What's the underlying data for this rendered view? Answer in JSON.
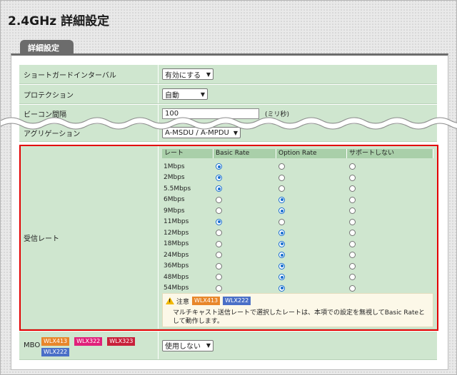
{
  "page": {
    "title": "2.4GHz 詳細設定"
  },
  "tab": {
    "label": "詳細設定"
  },
  "rows": {
    "short_guard": {
      "label": "ショートガードインターバル",
      "value": "有効にする"
    },
    "protection": {
      "label": "プロテクション",
      "value": "自動"
    },
    "beacon": {
      "label": "ビーコン間隔",
      "value": "100",
      "unit": "(ミリ秒)"
    },
    "aggregation": {
      "label": "アグリゲーション",
      "value": "A-MSDU / A-MPDU"
    },
    "receive_rate": {
      "label": "受信レート"
    },
    "mbo": {
      "label": "MBO",
      "value": "使用しない"
    }
  },
  "rate_table": {
    "headers": [
      "レート",
      "Basic Rate",
      "Option Rate",
      "サポートしない"
    ],
    "rates": [
      {
        "name": "1Mbps",
        "selected": "basic"
      },
      {
        "name": "2Mbps",
        "selected": "basic"
      },
      {
        "name": "5.5Mbps",
        "selected": "basic"
      },
      {
        "name": "6Mbps",
        "selected": "option"
      },
      {
        "name": "9Mbps",
        "selected": "option"
      },
      {
        "name": "11Mbps",
        "selected": "basic"
      },
      {
        "name": "12Mbps",
        "selected": "option"
      },
      {
        "name": "18Mbps",
        "selected": "option"
      },
      {
        "name": "24Mbps",
        "selected": "option"
      },
      {
        "name": "36Mbps",
        "selected": "option"
      },
      {
        "name": "48Mbps",
        "selected": "option"
      },
      {
        "name": "54Mbps",
        "selected": "option"
      }
    ]
  },
  "note": {
    "label": "注意",
    "text": "マルチキャスト送信レートで選択したレートは、本項での設定を無視してBasic Rateとして動作します。"
  },
  "model_badges": {
    "note": [
      {
        "text": "WLX413",
        "color": "#e8862a"
      },
      {
        "text": "WLX222",
        "color": "#4a6fc7"
      }
    ],
    "mbo": [
      {
        "text": "WLX413",
        "color": "#e8862a"
      },
      {
        "text": "WLX322",
        "color": "#e0207a"
      },
      {
        "text": "WLX323",
        "color": "#c8203a"
      },
      {
        "text": "WLX222",
        "color": "#4a6fc7"
      }
    ]
  }
}
